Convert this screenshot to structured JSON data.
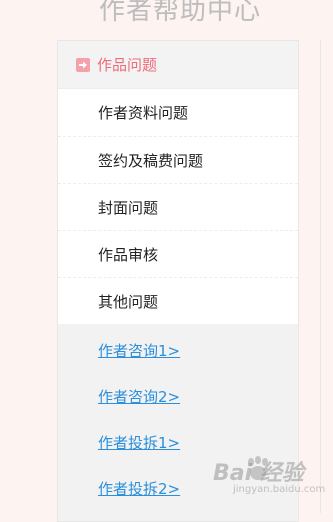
{
  "page": {
    "title": "作者帮助中心"
  },
  "category": {
    "label": "作品问题",
    "icon": "arrow-right-icon"
  },
  "menu_items": [
    "作者资料问题",
    "签约及稿费问题",
    "封面问题",
    "作品审核",
    "其他问题"
  ],
  "links": [
    "作者咨询1>",
    "作者咨询2>",
    "作者投拆1>",
    "作者投拆2>"
  ],
  "watermark": {
    "text": "Bai 经验",
    "sub": "jingyan.baidu.com"
  },
  "colors": {
    "accent": "#ee6c79",
    "link": "#2a8fdc",
    "background": "#fdf3f1"
  }
}
